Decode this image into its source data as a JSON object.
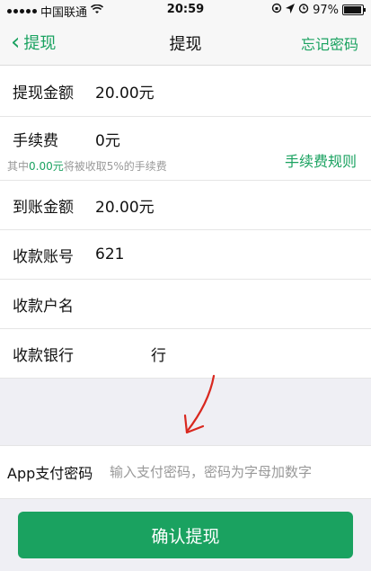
{
  "status_bar": {
    "carrier": "中国联通",
    "time": "20:59",
    "battery": "97%",
    "battery_level": 0.97
  },
  "nav": {
    "back_label": "提现",
    "title": "提现",
    "right_label": "忘记密码"
  },
  "rows": {
    "amount": {
      "label": "提现金额",
      "value": "20.00元"
    },
    "fee": {
      "label": "手续费",
      "value": "0元",
      "hint_prefix": "其中",
      "hint_amount": "0.00元",
      "hint_suffix": "将被收取5%的手续费",
      "rule_link": "手续费规则"
    },
    "received": {
      "label": "到账金额",
      "value": "20.00元"
    },
    "account": {
      "label": "收款账号",
      "value": "621"
    },
    "holder": {
      "label": "收款户名",
      "value": ""
    },
    "bank": {
      "label": "收款银行",
      "value": "行"
    }
  },
  "password": {
    "label": "App支付密码",
    "placeholder": "输入支付密码，密码为字母加数字"
  },
  "confirm_button": "确认提现",
  "colors": {
    "accent": "#1aa260",
    "annotation": "#d9281f"
  },
  "icons": [
    "signal-icon",
    "wifi-icon",
    "rotation-lock-icon",
    "location-icon",
    "alarm-icon",
    "battery-icon",
    "chevron-left-icon"
  ]
}
